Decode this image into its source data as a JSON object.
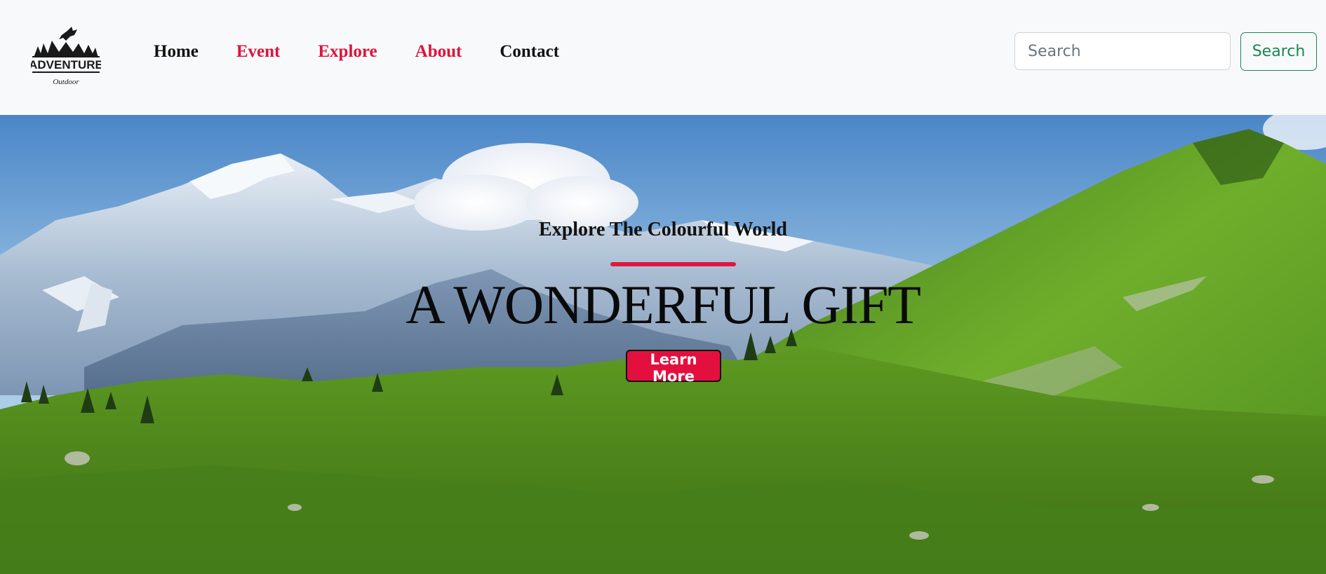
{
  "brand": {
    "logo_text": "ADVENTURE",
    "logo_subtext": "Outdoor",
    "logo_icon": "eagle-mountain-logo"
  },
  "nav": {
    "items": [
      {
        "label": "Home",
        "color": "#111111"
      },
      {
        "label": "Event",
        "color": "#dc143c"
      },
      {
        "label": "Explore",
        "color": "#dc143c"
      },
      {
        "label": "About",
        "color": "#dc143c"
      },
      {
        "label": "Contact",
        "color": "#111111"
      }
    ]
  },
  "search": {
    "placeholder": "Search",
    "value": "",
    "button_label": "Search",
    "button_color": "#198754"
  },
  "hero": {
    "subtitle": "Explore The Colourful World",
    "title": "A WONDERFUL GIFT",
    "cta_label": "Learn More",
    "accent_color": "#e3103f",
    "background": "mountain-landscape-image"
  }
}
